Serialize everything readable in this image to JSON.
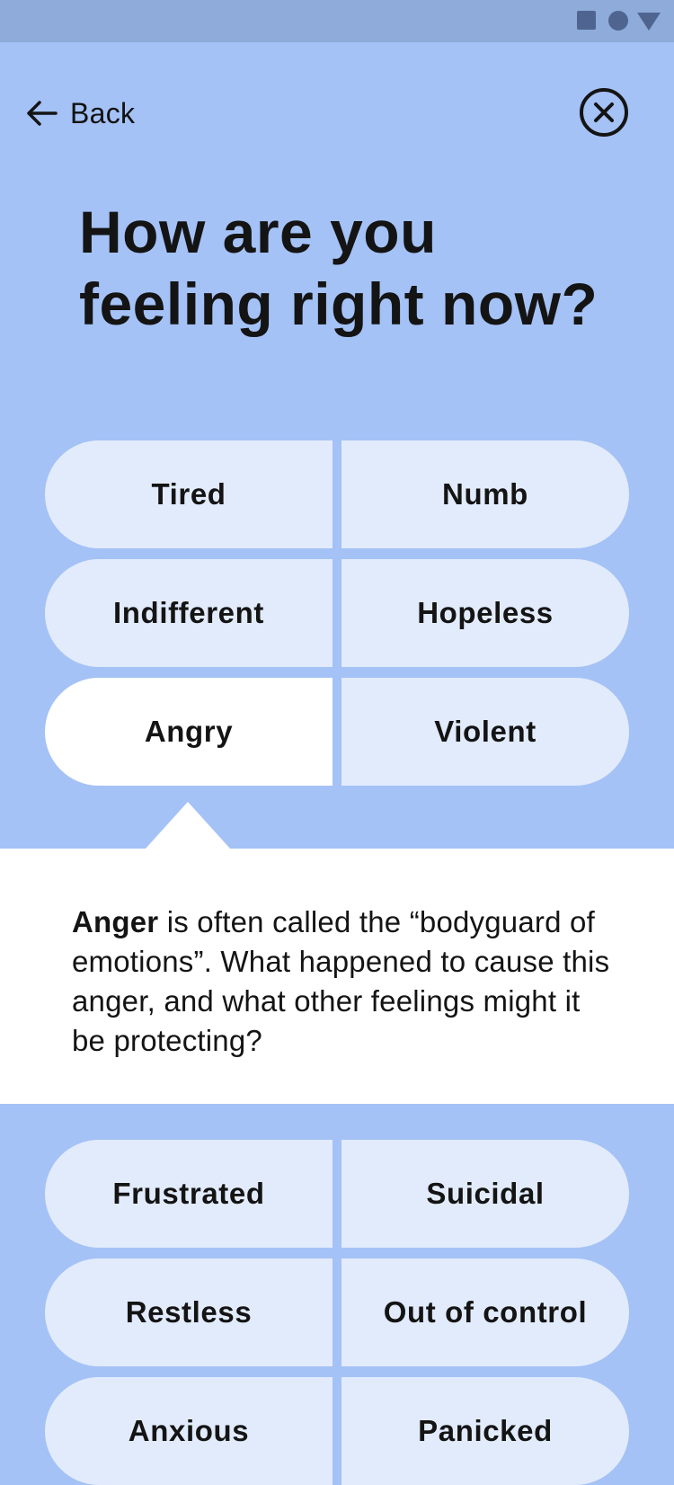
{
  "header": {
    "back_label": "Back"
  },
  "question": {
    "title": "How are you feeling right now?"
  },
  "feelings_top": [
    "Tired",
    "Numb",
    "Indifferent",
    "Hopeless",
    "Angry",
    "Violent"
  ],
  "selected_feeling": "Angry",
  "info_card": {
    "emphasis": "Anger",
    "text": " is often called the “bodyguard of emotions”. What happened to cause this anger, and what other feelings might it be protecting?"
  },
  "feelings_bottom": [
    "Frustrated",
    "Suicidal",
    "Restless",
    "Out of control",
    "Anxious",
    "Panicked"
  ],
  "colors": {
    "background": "#a4c2f6",
    "status_bar": "#8eabd9",
    "pill": "#e2ebfc",
    "pill_selected": "#ffffff",
    "text": "#141414"
  },
  "icons": {
    "back": "arrow-left-icon",
    "close": "close-circle-icon"
  }
}
